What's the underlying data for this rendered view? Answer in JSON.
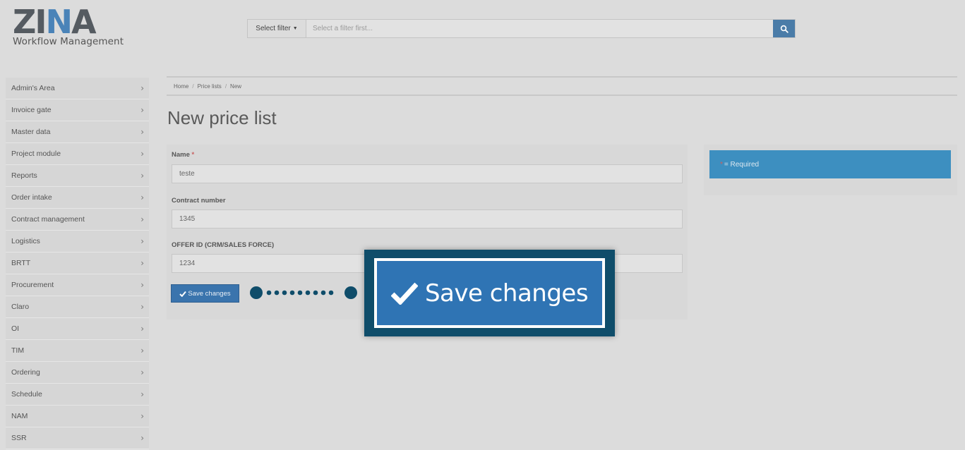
{
  "header": {
    "logo_text": "ZINA",
    "logo_subtitle": "Workflow Management",
    "filter_button_label": "Select filter",
    "search_placeholder": "Select a filter first...",
    "search_icon": "search-icon"
  },
  "sidebar": {
    "items": [
      {
        "label": "Admin's Area"
      },
      {
        "label": "Invoice gate"
      },
      {
        "label": "Master data"
      },
      {
        "label": "Project module"
      },
      {
        "label": "Reports"
      },
      {
        "label": "Order intake"
      },
      {
        "label": "Contract management"
      },
      {
        "label": "Logistics"
      },
      {
        "label": "BRTT"
      },
      {
        "label": "Procurement"
      },
      {
        "label": "Claro"
      },
      {
        "label": "OI"
      },
      {
        "label": "TIM"
      },
      {
        "label": "Ordering"
      },
      {
        "label": "Schedule"
      },
      {
        "label": "NAM"
      },
      {
        "label": "SSR"
      }
    ]
  },
  "breadcrumb": [
    "Home",
    "Price lists",
    "New"
  ],
  "page_title": "New price list",
  "form": {
    "name_label": "Name",
    "required_marker": "*",
    "name_value": "teste",
    "contract_label": "Contract number",
    "contract_value": "1345",
    "offer_label": "OFFER ID (CRM/SALES FORCE)",
    "offer_value": "1234",
    "save_label": "Save changes"
  },
  "required_note": {
    "marker": "*",
    "text": "= Required"
  },
  "callout": {
    "label": "Save changes",
    "icon": "checkmark-icon"
  },
  "colors": {
    "primary_button": "#3a74ad",
    "callout_frame": "#0f4d6a",
    "callout_button": "#2f74b4",
    "required_box": "#3d8fc0",
    "logo_accent": "#4a83b8"
  }
}
